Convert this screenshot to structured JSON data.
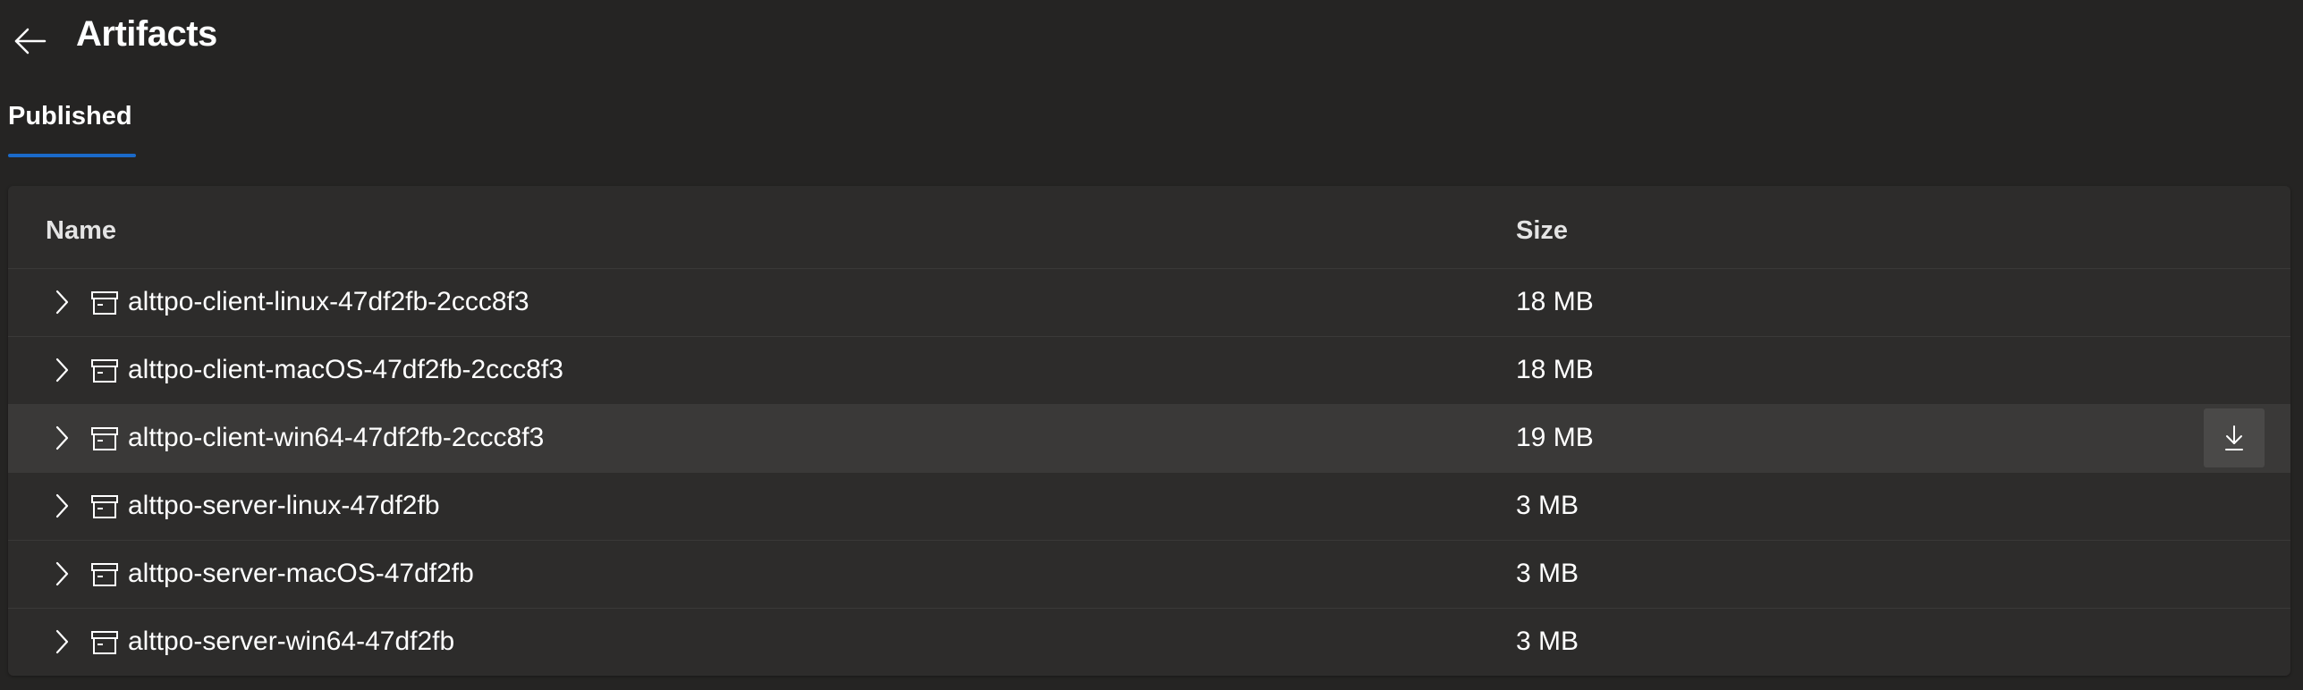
{
  "header": {
    "title": "Artifacts",
    "back_icon": "arrow-left-icon"
  },
  "tabs": [
    {
      "label": "Published",
      "selected": true
    }
  ],
  "colors": {
    "background": "#252423",
    "card": "#2d2c2b",
    "row_hover": "#3a3938",
    "accent": "#1b6ac9",
    "text": "#ffffff"
  },
  "table": {
    "columns": {
      "name": "Name",
      "size": "Size"
    },
    "rows": [
      {
        "name": "alttpo-client-linux-47df2fb-2ccc8f3",
        "size": "18 MB",
        "icon": "artifact-box-icon",
        "expand_icon": "chevron-right-icon"
      },
      {
        "name": "alttpo-client-macOS-47df2fb-2ccc8f3",
        "size": "18 MB",
        "icon": "artifact-box-icon",
        "expand_icon": "chevron-right-icon"
      },
      {
        "name": "alttpo-client-win64-47df2fb-2ccc8f3",
        "size": "19 MB",
        "icon": "artifact-box-icon",
        "expand_icon": "chevron-right-icon",
        "hovered": true,
        "action_icon": "download-icon"
      },
      {
        "name": "alttpo-server-linux-47df2fb",
        "size": "3 MB",
        "icon": "artifact-box-icon",
        "expand_icon": "chevron-right-icon"
      },
      {
        "name": "alttpo-server-macOS-47df2fb",
        "size": "3 MB",
        "icon": "artifact-box-icon",
        "expand_icon": "chevron-right-icon"
      },
      {
        "name": "alttpo-server-win64-47df2fb",
        "size": "3 MB",
        "icon": "artifact-box-icon",
        "expand_icon": "chevron-right-icon"
      }
    ]
  }
}
